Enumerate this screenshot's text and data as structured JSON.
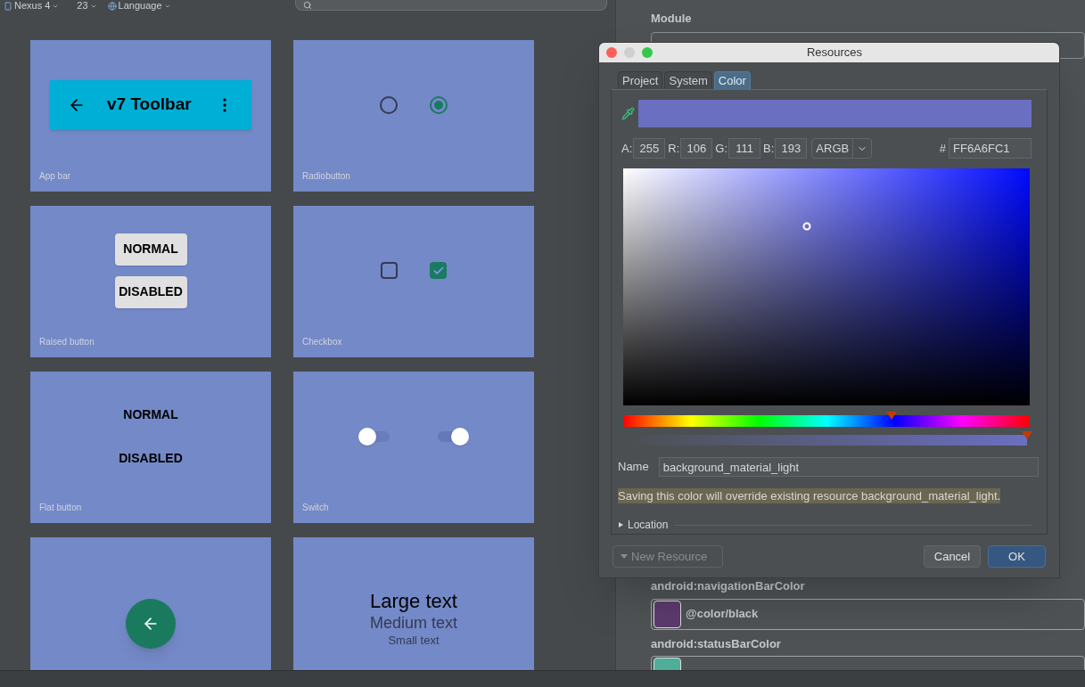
{
  "toolbar": {
    "device": "Nexus 4",
    "api": "23",
    "language": "Language"
  },
  "widgets": [
    {
      "kind": "appbar",
      "label": "App bar",
      "title": "v7 Toolbar"
    },
    {
      "kind": "radio",
      "label": "Radiobutton",
      "options": [
        {
          "selected": false
        },
        {
          "selected": true
        }
      ]
    },
    {
      "kind": "raised",
      "label": "Raised button",
      "buttons": [
        "NORMAL",
        "DISABLED"
      ]
    },
    {
      "kind": "checkbox",
      "label": "Checkbox",
      "boxes": [
        {
          "checked": false
        },
        {
          "checked": true
        }
      ]
    },
    {
      "kind": "flat",
      "label": "Flat button",
      "buttons": [
        "NORMAL",
        "DISABLED"
      ]
    },
    {
      "kind": "switch",
      "label": "Switch",
      "switches": [
        {
          "on": false
        },
        {
          "on": true
        }
      ]
    },
    {
      "kind": "fab"
    },
    {
      "kind": "text",
      "texts": [
        "Large text",
        "Medium text",
        "Small text"
      ]
    }
  ],
  "module": {
    "label": "Module"
  },
  "attributes": [
    {
      "name": "android:navigationBarColor",
      "value": "@color/black",
      "color": "#5c3a6e"
    },
    {
      "name": "android:statusBarColor",
      "color": "#4fae98"
    }
  ],
  "dialog": {
    "title": "Resources",
    "tabs": [
      {
        "label": "Project",
        "selected": false
      },
      {
        "label": "System",
        "selected": false
      },
      {
        "label": "Color",
        "selected": true
      }
    ],
    "channels": [
      {
        "label": "A:",
        "value": "255"
      },
      {
        "label": "R:",
        "value": "106"
      },
      {
        "label": "G:",
        "value": "111"
      },
      {
        "label": "B:",
        "value": "193"
      }
    ],
    "format": "ARGB",
    "hash": "#",
    "hex": "FF6A6FC1",
    "hue": {
      "level": 0.66
    },
    "alpha": {
      "level": 1
    },
    "name_label": "Name",
    "name_value": "background_material_light",
    "warning": "Saving this color will override existing resource background_material_light.",
    "location": {
      "label": "Location",
      "expanded": false
    },
    "buttons": [
      {
        "label": "New Resource",
        "kind": "dropdown",
        "disabled": true
      },
      {
        "label": "Cancel",
        "kind": "plain",
        "disabled": false
      },
      {
        "label": "OK",
        "kind": "default",
        "disabled": false
      }
    ]
  }
}
